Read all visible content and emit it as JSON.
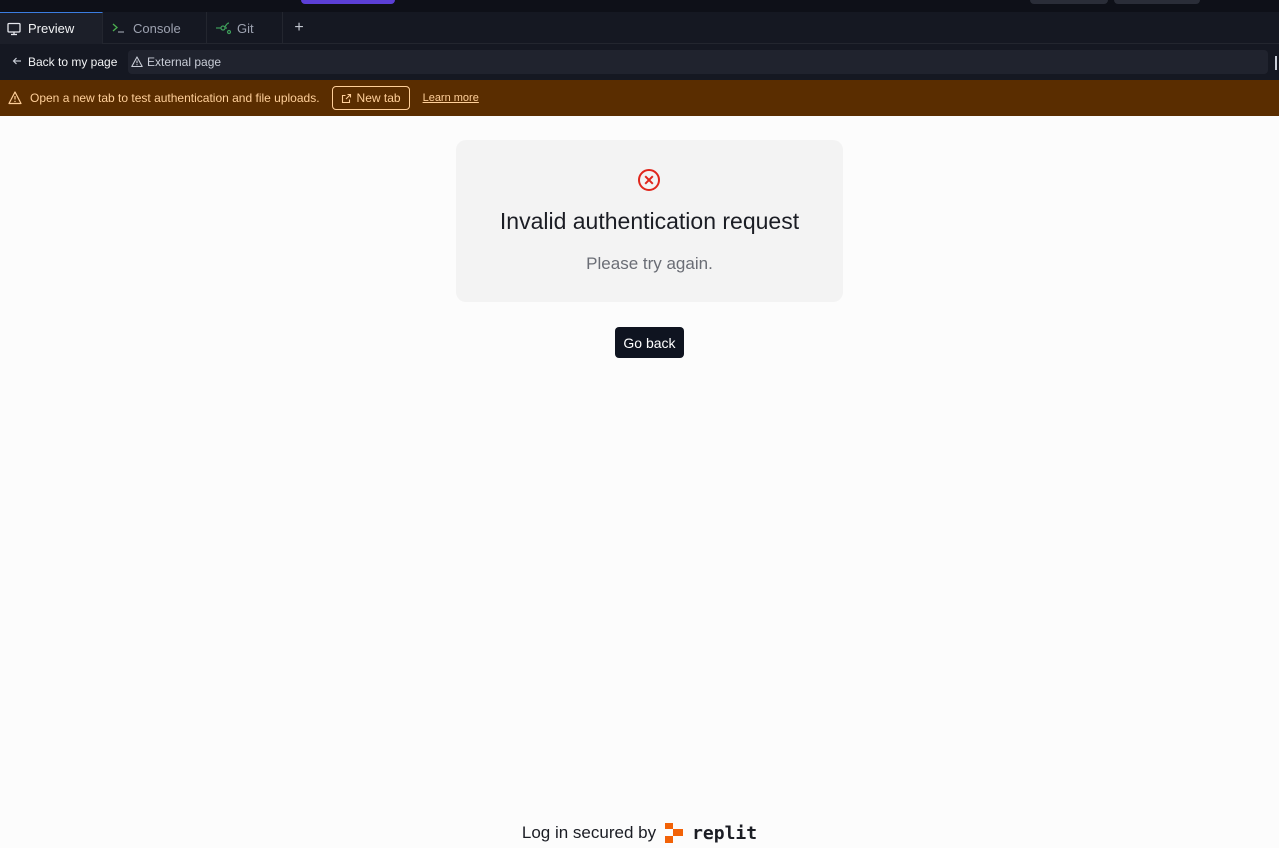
{
  "tabs": [
    {
      "label": "Preview",
      "icon": "monitor-icon",
      "active": true
    },
    {
      "label": "Console",
      "icon": "terminal-icon",
      "active": false
    },
    {
      "label": "Git",
      "icon": "git-branch-icon",
      "active": false
    }
  ],
  "tab_add_label": "+",
  "addressbar": {
    "back_label": "Back to my page",
    "url_label": "External page"
  },
  "banner": {
    "message": "Open a new tab to test authentication and file uploads.",
    "new_tab_label": "New tab",
    "learn_more_label": "Learn more",
    "color": "#5a2d00"
  },
  "error_card": {
    "title": "Invalid authentication request",
    "subtitle": "Please try again.",
    "icon": "error-x-circle-icon",
    "icon_color": "#e0261c"
  },
  "go_back_label": "Go back",
  "footer": {
    "text": "Log in secured by",
    "brand": "replit",
    "brand_color": "#f26207"
  }
}
